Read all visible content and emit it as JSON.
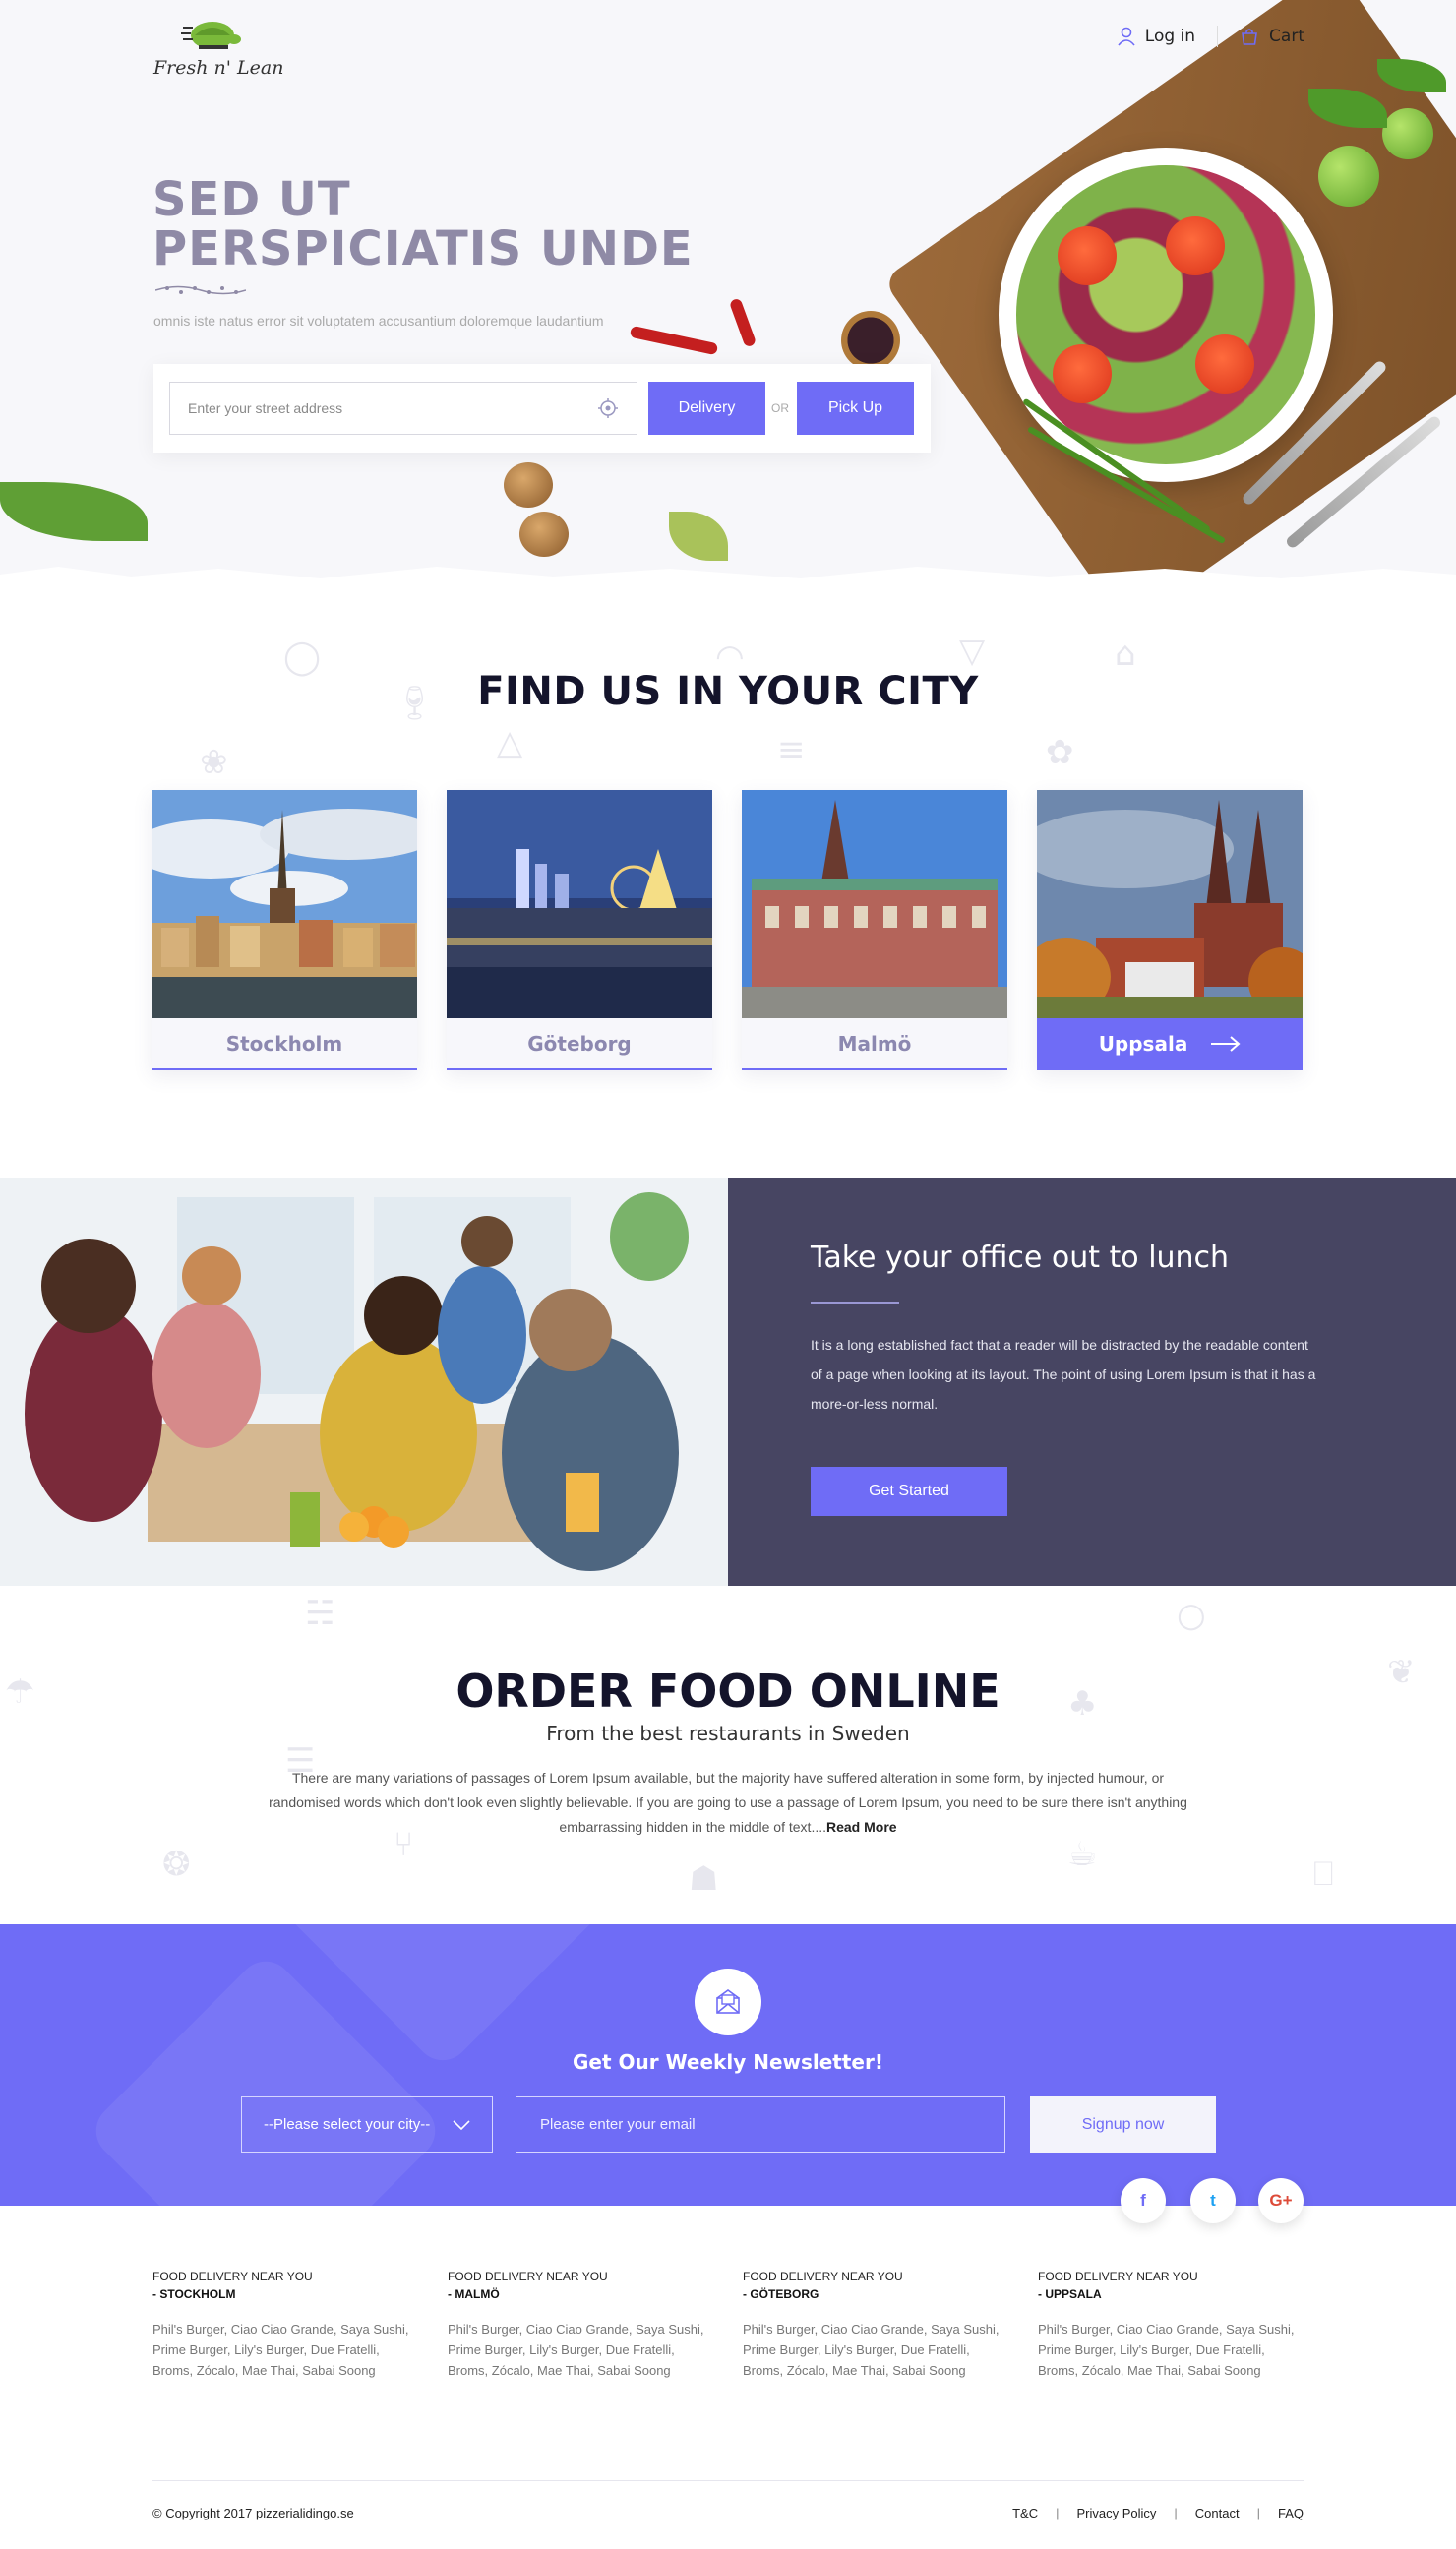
{
  "brand": {
    "name": "Fresh n' Lean",
    "accent_color": "#6f6cf6",
    "dark_panel_color": "#474562"
  },
  "topnav": {
    "login": "Log in",
    "cart": "Cart"
  },
  "hero": {
    "title": "SED UT PERSPICIATIS UNDE",
    "subtitle": "omnis iste natus error sit voluptatem accusantium doloremque laudantium",
    "address_placeholder": "Enter your street address",
    "delivery_label": "Delivery",
    "or_label": "OR",
    "pickup_label": "Pick Up"
  },
  "find_us": {
    "title": "FIND US IN YOUR CITY",
    "cities": [
      {
        "name": "Stockholm"
      },
      {
        "name": "Göteborg"
      },
      {
        "name": "Malmö"
      },
      {
        "name": "Uppsala",
        "active": true
      }
    ]
  },
  "lunch": {
    "title": "Take your office out to lunch",
    "text": "It is a long established fact that a reader will be distracted by the readable content of a page when looking at its layout. The point of using Lorem Ipsum is that it has a more-or-less normal.",
    "button": "Get Started"
  },
  "order": {
    "title": "ORDER FOOD ONLINE",
    "subtitle": "From the best restaurants in Sweden",
    "text": "There are many variations of passages of Lorem Ipsum available, but the majority have suffered alteration in some form, by injected humour, or randomised words which don't look even slightly believable. If you are going to use a passage of Lorem Ipsum, you need to be sure there isn't anything embarrassing hidden in the middle of text....",
    "read_more": "Read More"
  },
  "newsletter": {
    "title": "Get Our Weekly Newsletter!",
    "city_select": "--Please select your city--",
    "email_placeholder": "Please enter your email",
    "signup": "Signup now"
  },
  "social": {
    "facebook": "f",
    "twitter": "t",
    "google": "G+"
  },
  "footer": {
    "columns": [
      {
        "heading": "FOOD DELIVERY NEAR YOU",
        "city": "- STOCKHOLM",
        "restaurants": "Phil's Burger, Ciao Ciao Grande, Saya Sushi, Prime Burger, Lily's Burger, Due Fratelli, Broms, Zócalo, Mae Thai, Sabai Soong"
      },
      {
        "heading": "FOOD DELIVERY NEAR YOU",
        "city": "-  MALMÖ",
        "restaurants": "Phil's Burger, Ciao Ciao Grande, Saya Sushi, Prime Burger, Lily's Burger, Due Fratelli, Broms, Zócalo, Mae Thai, Sabai Soong"
      },
      {
        "heading": "FOOD DELIVERY NEAR YOU",
        "city": "-  GÖTEBORG",
        "restaurants": "Phil's Burger, Ciao Ciao Grande, Saya Sushi, Prime Burger, Lily's Burger, Due Fratelli, Broms, Zócalo, Mae Thai, Sabai Soong"
      },
      {
        "heading": "FOOD DELIVERY NEAR YOU",
        "city": "-  UPPSALA",
        "restaurants": "Phil's Burger, Ciao Ciao Grande, Saya Sushi, Prime Burger, Lily's Burger, Due Fratelli, Broms, Zócalo, Mae Thai, Sabai Soong"
      }
    ],
    "copyright": "© Copyright 2017  pizzerialidingo.se",
    "links": {
      "tc": "T&C",
      "privacy": "Privacy Policy",
      "contact": "Contact",
      "faq": "FAQ"
    }
  }
}
